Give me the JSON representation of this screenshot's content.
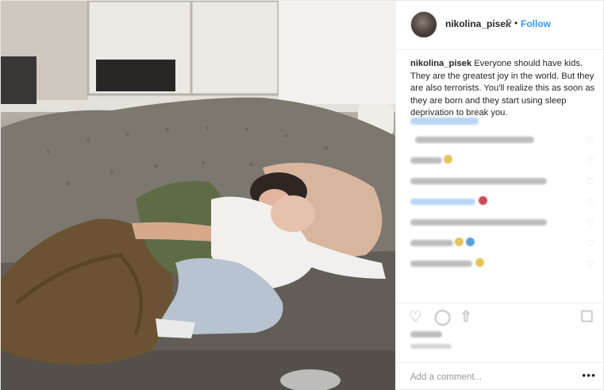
{
  "post": {
    "username": "nikolina_pisek",
    "verified_icon": "verified-badge-icon",
    "separator": "•",
    "follow_label": "Follow",
    "caption": {
      "username": "nikolina_pisek",
      "text": "Everyone should have kids. They are the greatest joy in the world. But they are also terrorists. You'll realize this as soon as they are born and they start using sleep deprivation to break you."
    },
    "add_comment_placeholder": "Add a comment...",
    "more_label": "•••",
    "colors": {
      "link": "#3897f0",
      "text": "#262626",
      "muted": "#999999"
    },
    "icons": [
      "like-icon",
      "comment-icon",
      "share-icon",
      "save-icon",
      "heart-icon"
    ]
  }
}
